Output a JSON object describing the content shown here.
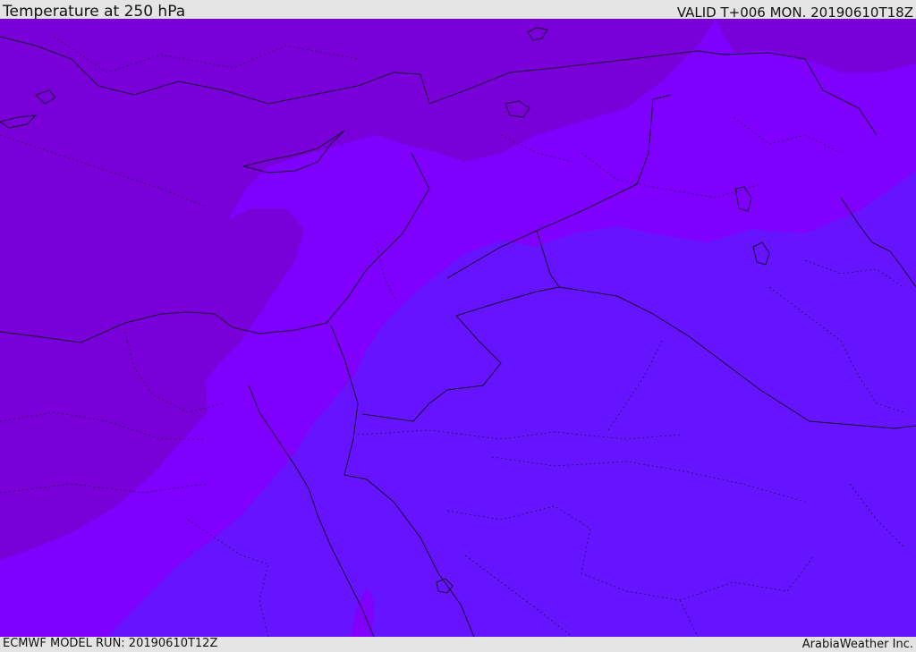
{
  "header": {
    "title": "Temperature at 250 hPa",
    "valid": "VALID T+006 MON. 20190610T18Z"
  },
  "footer": {
    "model_run": "ECMWF MODEL RUN: 20190610T12Z",
    "credit": "ArabiaWeather Inc."
  },
  "map": {
    "colors": {
      "zone_warm": "#7a00d9",
      "zone_mid": "#7f00ff",
      "zone_cool": "#6614ff",
      "border_line": "#1a0a33"
    }
  }
}
